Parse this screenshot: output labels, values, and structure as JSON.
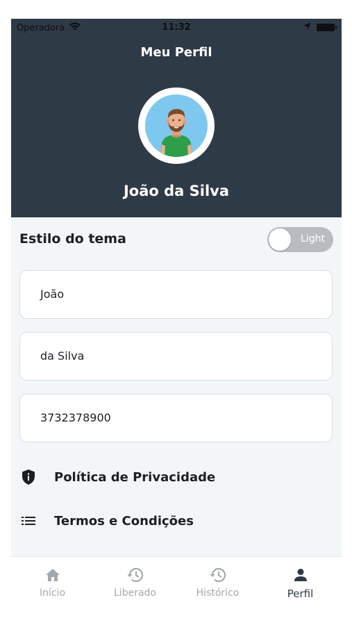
{
  "status_bar": {
    "carrier": "Operadora",
    "time": "11:32"
  },
  "header": {
    "title": "Meu Perfil",
    "user_name": "João da Silva"
  },
  "theme": {
    "label": "Estilo do tema",
    "toggle_value": "Light"
  },
  "form": {
    "first_name": "João",
    "last_name": "da Silva",
    "phone": "3732378900"
  },
  "links": [
    {
      "label": "Política de Privacidade",
      "icon": "shield-icon"
    },
    {
      "label": "Termos e Condições",
      "icon": "list-icon"
    }
  ],
  "tabs": [
    {
      "label": "Início",
      "icon": "home-icon",
      "active": false
    },
    {
      "label": "Liberado",
      "icon": "history-icon",
      "active": false
    },
    {
      "label": "Histórico",
      "icon": "history-icon",
      "active": false
    },
    {
      "label": "Perfil",
      "icon": "person-icon",
      "active": true
    }
  ],
  "colors": {
    "header_bg": "#2f3a47",
    "content_bg": "#f3f6f9",
    "toggle_bg": "#b8bcc1",
    "tab_inactive": "#a3a8ae",
    "tab_active": "#2f3a47"
  }
}
